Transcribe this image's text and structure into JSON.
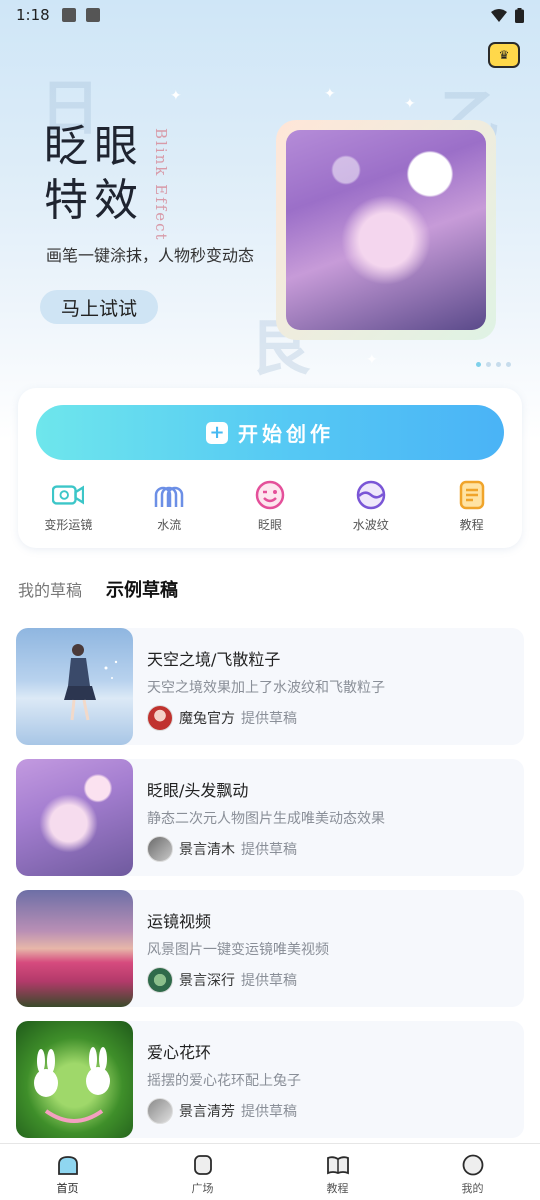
{
  "status_bar": {
    "time": "1:18"
  },
  "hero": {
    "title_line1": "眨眼",
    "title_line2": "特效",
    "subtitle_en": "Blink Effect",
    "description": "画笔一键涂抹，人物秒变动态",
    "try_button": "马上试试",
    "carousel_total": 4,
    "carousel_active": 1
  },
  "create_button": "开始创作",
  "tools": [
    {
      "label": "变形运镜",
      "icon": "camera-morph-icon"
    },
    {
      "label": "水流",
      "icon": "water-flow-icon"
    },
    {
      "label": "眨眼",
      "icon": "wink-face-icon"
    },
    {
      "label": "水波纹",
      "icon": "water-ripple-icon"
    },
    {
      "label": "教程",
      "icon": "tutorial-doc-icon"
    }
  ],
  "tabs": {
    "my_drafts": "我的草稿",
    "sample_drafts": "示例草稿",
    "active": "sample_drafts"
  },
  "drafts": [
    {
      "title": "天空之境/飞散粒子",
      "desc": "天空之境效果加上了水波纹和飞散粒子",
      "author": "魔兔官方",
      "suffix": "提供草稿"
    },
    {
      "title": "眨眼/头发飘动",
      "desc": "静态二次元人物图片生成唯美动态效果",
      "author": "景言清木",
      "suffix": "提供草稿"
    },
    {
      "title": "运镜视频",
      "desc": "风景图片一键变运镜唯美视频",
      "author": "景言深行",
      "suffix": "提供草稿"
    },
    {
      "title": "爱心花环",
      "desc": "摇摆的爱心花环配上兔子",
      "author": "景言清芳",
      "suffix": "提供草稿"
    }
  ],
  "bottom_nav": [
    {
      "label": "首页",
      "icon": "home-icon",
      "active": true
    },
    {
      "label": "广场",
      "icon": "square-icon",
      "active": false
    },
    {
      "label": "教程",
      "icon": "book-icon",
      "active": false
    },
    {
      "label": "我的",
      "icon": "profile-icon",
      "active": false
    }
  ],
  "colors": {
    "accent": "#4ab3f6",
    "card_bg": "#f6f8fc",
    "crown": "#ffd84a"
  }
}
